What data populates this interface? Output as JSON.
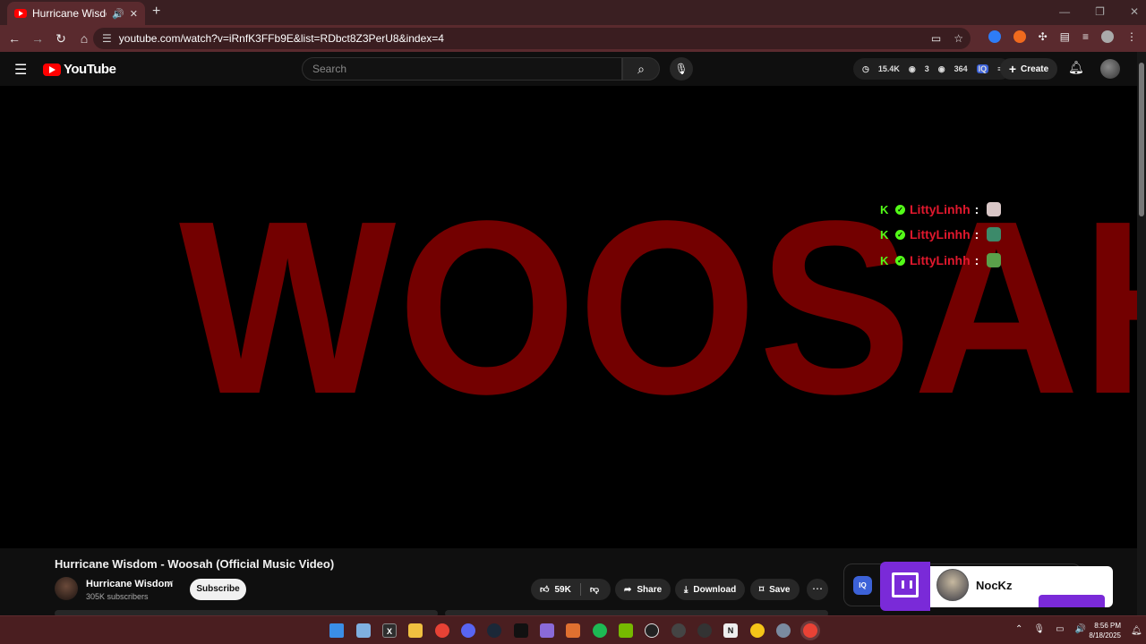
{
  "browser": {
    "tab_title": "Hurricane Wisdom - Woosah",
    "url": "youtube.com/watch?v=iRnfK3FFb9E&list=RDbct8Z3PerU8&index=4"
  },
  "youtube": {
    "logo_text": "YouTube",
    "search_placeholder": "Search",
    "stats": {
      "views": "15.4K",
      "eyes": "3",
      "viewers": "364"
    },
    "create_label": "Create"
  },
  "player": {
    "video_text": "WOOSAH",
    "chat": [
      {
        "user": "LittyLinhh",
        "sep": ":"
      },
      {
        "user": "LittyLinhh",
        "sep": ":"
      },
      {
        "user": "LittyLinhh",
        "sep": ":"
      }
    ]
  },
  "video": {
    "title": "Hurricane Wisdom - Woosah (Official Music Video)",
    "channel": "Hurricane Wisdom",
    "subscribers": "305K subscribers",
    "subscribe_label": "Subscribe",
    "likes": "59K",
    "share_label": "Share",
    "download_label": "Download",
    "save_label": "Save"
  },
  "overlay": {
    "iq_label": "IQ",
    "streamer": "NocKz"
  },
  "taskbar": {
    "time": "8:56 PM",
    "date": "8/18/2025"
  },
  "colors": {
    "accent": "#ff0000",
    "twitch": "#7a2ad8",
    "kick": "#53fc18",
    "woosah": "#730000"
  }
}
